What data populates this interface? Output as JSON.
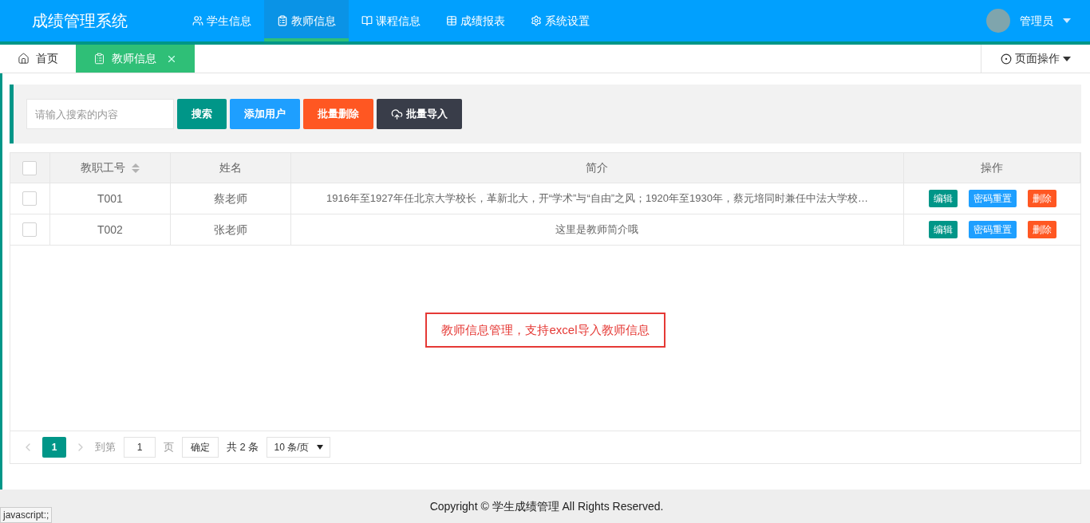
{
  "header": {
    "logo": "成绩管理系统",
    "nav": [
      {
        "label": "学生信息",
        "selected": false
      },
      {
        "label": "教师信息",
        "selected": true
      },
      {
        "label": "课程信息",
        "selected": false
      },
      {
        "label": "成绩报表",
        "selected": false
      },
      {
        "label": "系统设置",
        "selected": false
      }
    ],
    "user": "管理员"
  },
  "tabs": [
    {
      "label": "首页",
      "closable": false,
      "selected": false
    },
    {
      "label": "教师信息",
      "closable": true,
      "selected": true
    }
  ],
  "page_actions": "页面操作",
  "toolbar": {
    "search": {
      "placeholder": "请输入搜索的内容"
    },
    "buttons": [
      {
        "label": "搜索",
        "kind": "search"
      },
      {
        "label": "添加用户",
        "kind": "add"
      },
      {
        "label": "批量删除",
        "kind": "danger"
      },
      {
        "label": "批量导入",
        "kind": "import"
      }
    ]
  },
  "table": {
    "columns": [
      {
        "label": "教职工号",
        "sortable": true
      },
      {
        "label": "姓名",
        "sortable": false
      },
      {
        "label": "简介",
        "sortable": false
      },
      {
        "label": "操作",
        "sortable": false
      }
    ],
    "header_checked": false,
    "rows": [
      {
        "checked": false,
        "cells": [
          "T001",
          "蔡老师",
          "1916年至1927年任北京大学校长，革新北大，开“学术”与“自由”之风；1920年至1930年，蔡元培同时兼任中法大学校…"
        ],
        "actions": [
          {
            "label": "编辑",
            "kind": "edit"
          },
          {
            "label": "密码重置",
            "kind": "reset"
          },
          {
            "label": "删除",
            "kind": "delete"
          }
        ]
      },
      {
        "checked": false,
        "cells": [
          "T002",
          "张老师",
          "这里是教师简介哦"
        ],
        "actions": [
          {
            "label": "编辑",
            "kind": "edit"
          },
          {
            "label": "密码重置",
            "kind": "reset"
          },
          {
            "label": "删除",
            "kind": "delete"
          }
        ]
      }
    ]
  },
  "note": "教师信息管理，支持excel导入教师信息",
  "pagination": {
    "pages": [
      {
        "label": "1",
        "selected": true
      }
    ],
    "goto_label": "到第",
    "goto_value": "1",
    "page_unit": "页",
    "confirm": "确定",
    "total": "共 2 条",
    "page_size": "10 条/页"
  },
  "footer": "Copyright © 学生成绩管理 All Rights Reserved.",
  "status_bar": "javascript:;"
}
